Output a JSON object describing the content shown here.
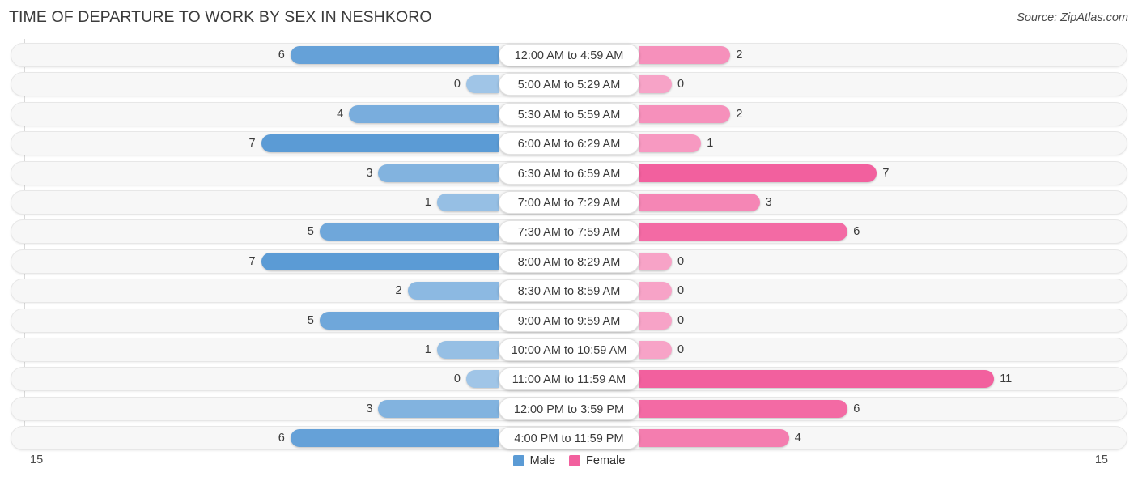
{
  "header": {
    "title": "TIME OF DEPARTURE TO WORK BY SEX IN NESHKORO",
    "source": "Source: ZipAtlas.com"
  },
  "legend": {
    "male_label": "Male",
    "female_label": "Female",
    "male_color": "#5b9bd5",
    "female_color": "#f2609e"
  },
  "axis": {
    "left_end": "15",
    "right_end": "15",
    "max": 15
  },
  "chart_data": {
    "type": "bar",
    "title": "TIME OF DEPARTURE TO WORK BY SEX IN NESHKORO",
    "subtitle": "",
    "xlabel": "",
    "ylabel": "",
    "orientation": "horizontal-diverging",
    "legend_position": "bottom-center",
    "grid": false,
    "xlim": [
      15,
      15
    ],
    "categories": [
      "12:00 AM to 4:59 AM",
      "5:00 AM to 5:29 AM",
      "5:30 AM to 5:59 AM",
      "6:00 AM to 6:29 AM",
      "6:30 AM to 6:59 AM",
      "7:00 AM to 7:29 AM",
      "7:30 AM to 7:59 AM",
      "8:00 AM to 8:29 AM",
      "8:30 AM to 8:59 AM",
      "9:00 AM to 9:59 AM",
      "10:00 AM to 10:59 AM",
      "11:00 AM to 11:59 AM",
      "12:00 PM to 3:59 PM",
      "4:00 PM to 11:59 PM"
    ],
    "series": [
      {
        "name": "Male",
        "color": "#5b9bd5",
        "values": [
          6,
          0,
          4,
          7,
          3,
          1,
          5,
          7,
          2,
          5,
          1,
          0,
          3,
          6
        ]
      },
      {
        "name": "Female",
        "color": "#f2609e",
        "values": [
          2,
          0,
          2,
          1,
          7,
          3,
          6,
          0,
          0,
          0,
          0,
          11,
          6,
          4
        ]
      }
    ]
  }
}
